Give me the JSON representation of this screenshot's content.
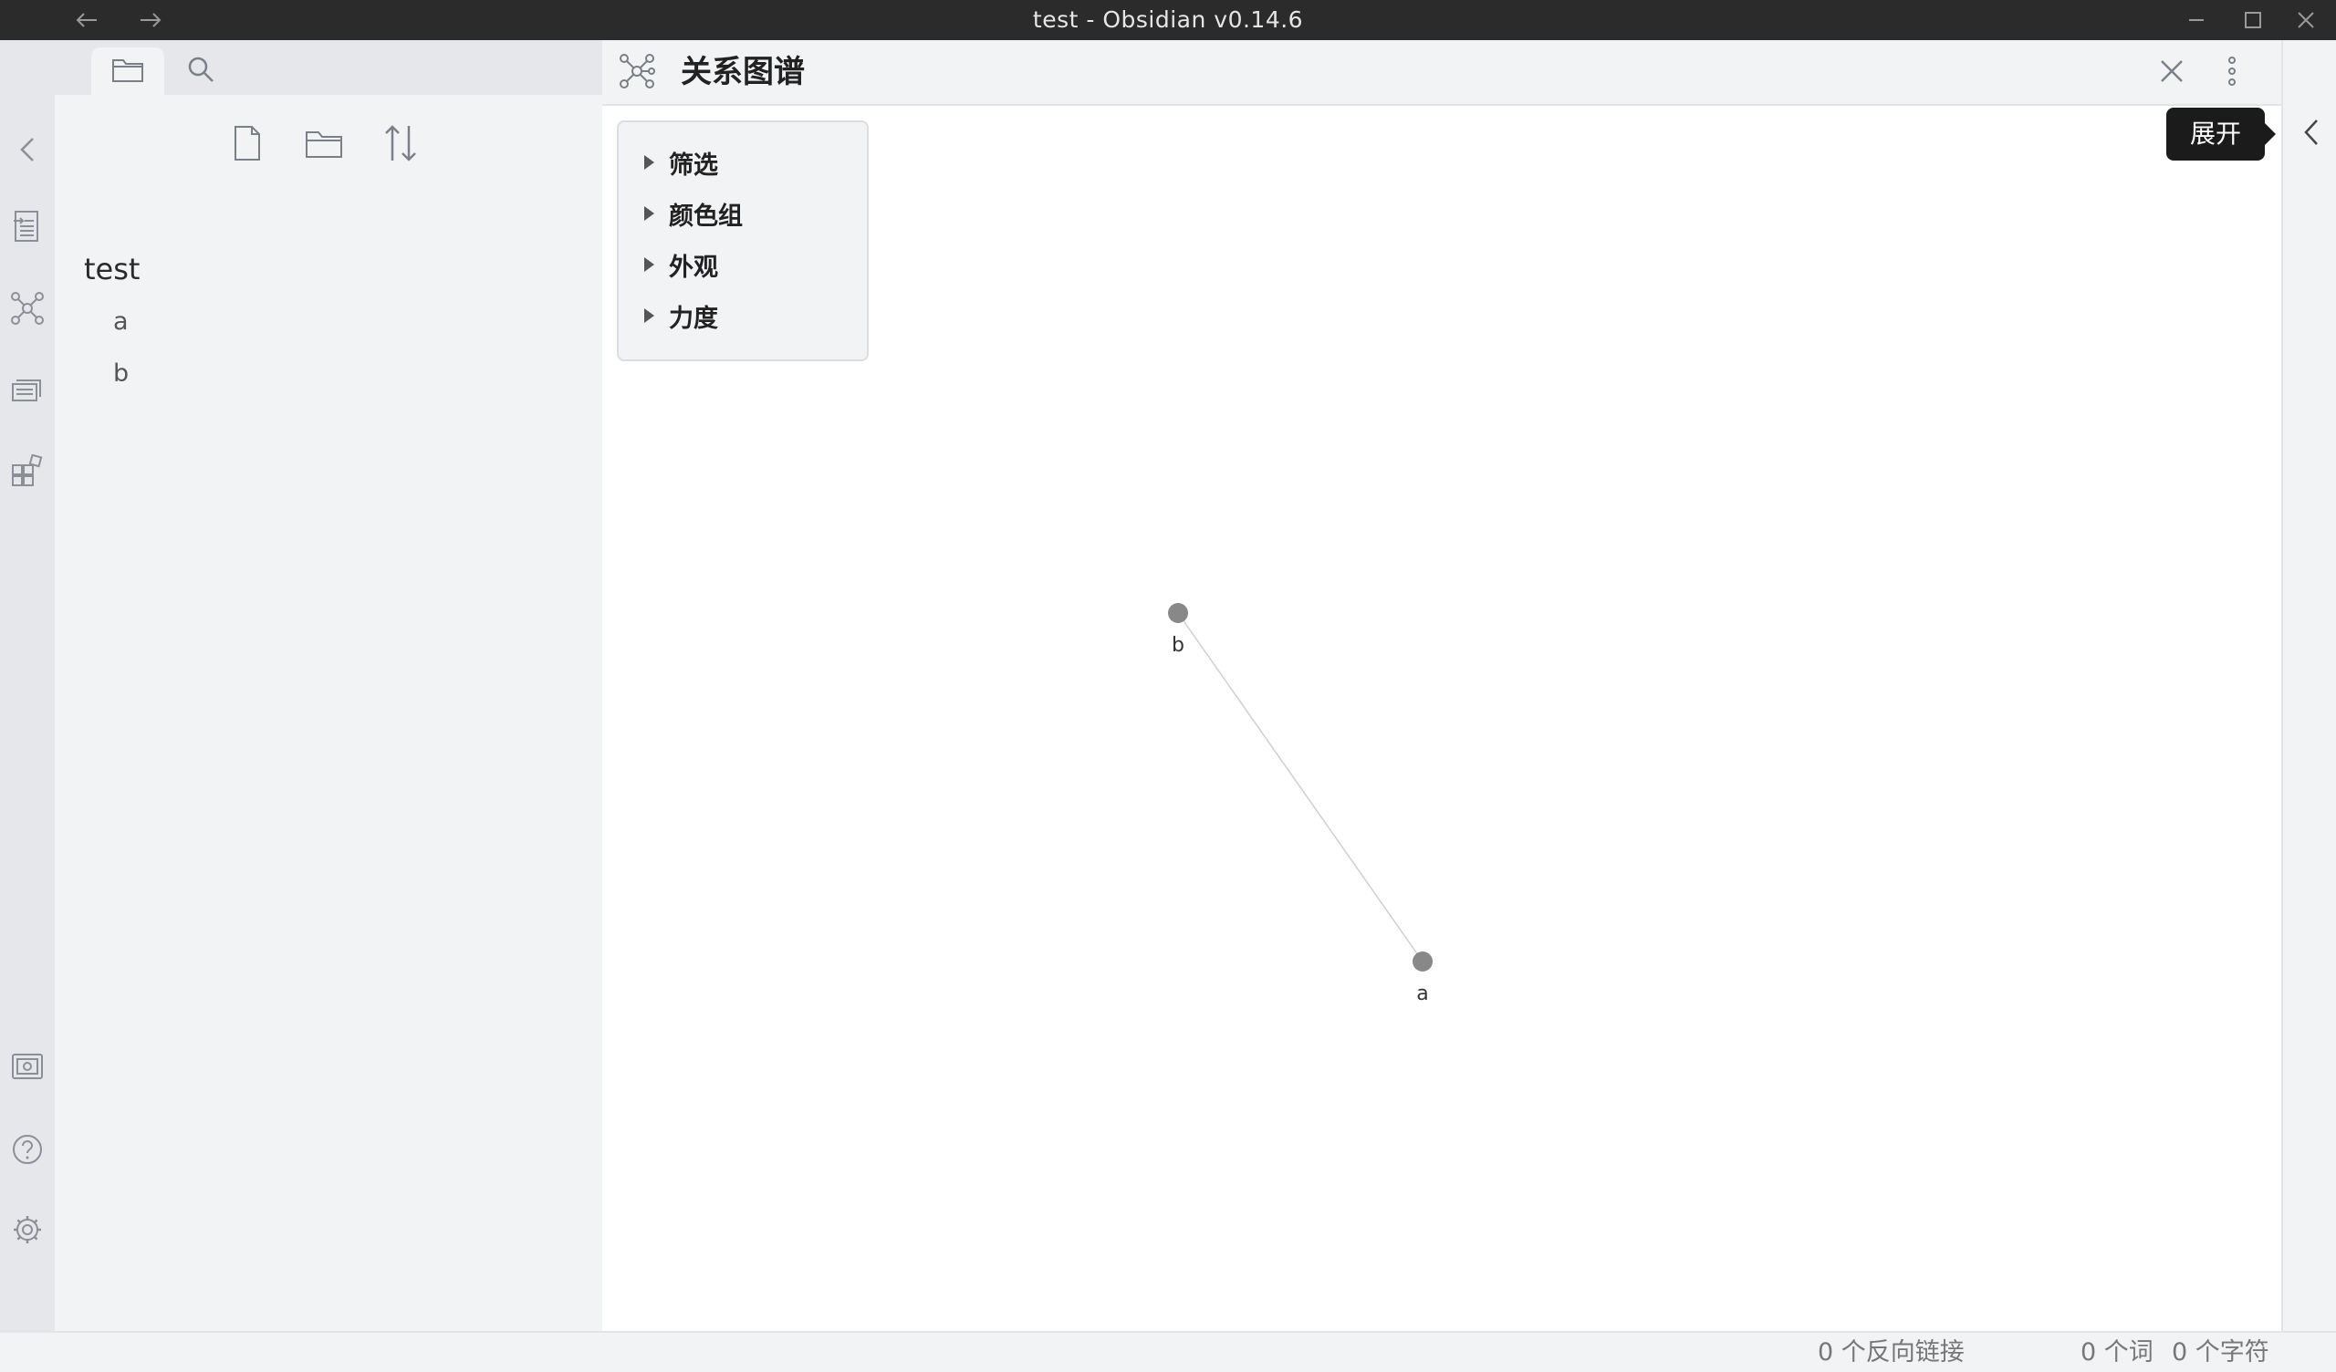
{
  "window": {
    "title": "test - Obsidian v0.14.6"
  },
  "ribbon": {
    "icons": [
      "chevron-left-icon",
      "quick-switcher-icon",
      "graph-view-icon",
      "slides-icon",
      "plugins-grid-icon",
      "vault-icon",
      "help-icon",
      "settings-icon"
    ]
  },
  "sidebar": {
    "tabs": [
      "folder-icon",
      "search-icon"
    ],
    "actions": [
      "new-note-icon",
      "new-folder-icon",
      "sort-icon"
    ],
    "vault_name": "test",
    "files": [
      {
        "label": "a"
      },
      {
        "label": "b"
      }
    ]
  },
  "pane": {
    "title": "关系图谱",
    "controls": [
      {
        "label": "筛选"
      },
      {
        "label": "颜色组"
      },
      {
        "label": "外观"
      },
      {
        "label": "力度"
      }
    ]
  },
  "graph": {
    "nodes": [
      {
        "id": "b",
        "label": "b"
      },
      {
        "id": "a",
        "label": "a"
      }
    ],
    "edges": [
      {
        "from": "b",
        "to": "a"
      }
    ],
    "node_color": "#888888",
    "edge_color": "#cfcfcf"
  },
  "tooltip": {
    "text": "展开"
  },
  "status": {
    "backlinks": "0 个反向链接",
    "words": "0 个词",
    "chars": "0 个字符"
  }
}
